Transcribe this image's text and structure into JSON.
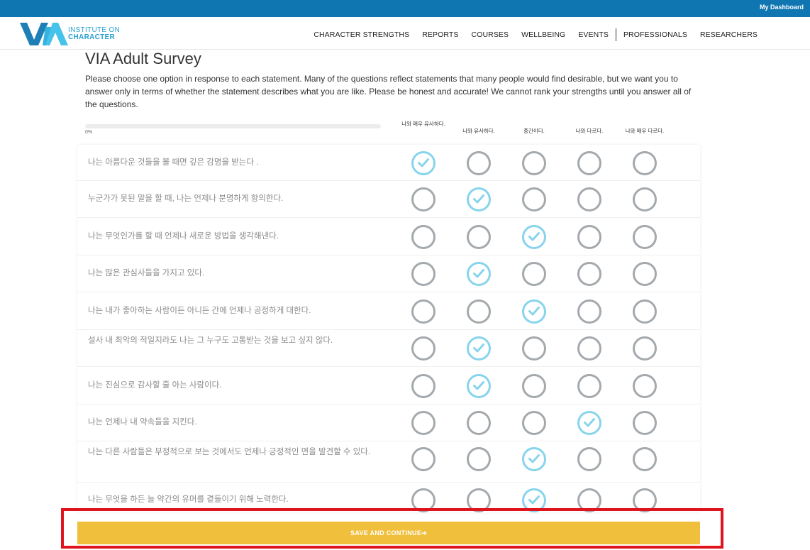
{
  "topbar": {
    "dashboard_link": "My Dashboard"
  },
  "logo": {
    "mark": "VIA",
    "line1": "INSTITUTE ON",
    "line2": "CHARACTER"
  },
  "nav": {
    "items": [
      "CHARACTER STRENGTHS",
      "REPORTS",
      "COURSES",
      "WELLBEING",
      "EVENTS",
      "PROFESSIONALS",
      "RESEARCHERS"
    ]
  },
  "page": {
    "title": "VIA Adult Survey",
    "intro": "Please choose one option in response to each statement. Many of the questions reflect statements that many people would find desirable, but we want you to answer only in terms of whether the statement describes what you are like. Please be honest and accurate! We cannot rank your strengths until you answer all of the questions."
  },
  "progress": {
    "label": "0%",
    "value": 0
  },
  "columns": [
    "나와 매우 유사하다.",
    "나와 유사하다.",
    "중간이다.",
    "나와 다르다.",
    "나와 매우 다르다."
  ],
  "questions": [
    {
      "text": "나는 아름다운 것들을 볼 때면 깊은 감명을 받는다 .",
      "selected": 0
    },
    {
      "text": "누군가가 못된 말을 할 때, 나는 언제나 분명하게 항의한다.",
      "selected": 1
    },
    {
      "text": "나는 무엇인가를 할 때 언제나 새로운 방법을 생각해낸다.",
      "selected": 2
    },
    {
      "text": "나는 많은 관심사들을 가지고 있다.",
      "selected": 1
    },
    {
      "text": "나는 내가 좋아하는 사람이든 아니든 간에 언제나 공정하게 대한다.",
      "selected": 2
    },
    {
      "text": "설사 내 최악의 적일지라도 나는 그 누구도 고통받는 것을 보고 싶지 않다.",
      "selected": 1
    },
    {
      "text": "나는 진심으로 감사할 줄 아는 사람이다.",
      "selected": 1
    },
    {
      "text": "나는 언제나 내 약속들을 지킨다.",
      "selected": 3
    },
    {
      "text": "나는 다른 사람들은 부정적으로 보는 것에서도 언제나 긍정적인 면을 발견할 수 있다.",
      "selected": 2
    },
    {
      "text": "나는 무엇을 하든 늘 약간의 유머를 곁들이기 위해 노력한다.",
      "selected": 2
    }
  ],
  "save_button": "SAVE AND CONTINUE➔",
  "colors": {
    "topbar": "#0f76b1",
    "selected_circle": "#87d4ec",
    "unselected_circle": "#a4a9ad",
    "save_button": "#f0bf3c",
    "highlight_border": "#e0141e"
  },
  "icons": {
    "check": "check-icon",
    "logo": "via-logo-icon"
  }
}
